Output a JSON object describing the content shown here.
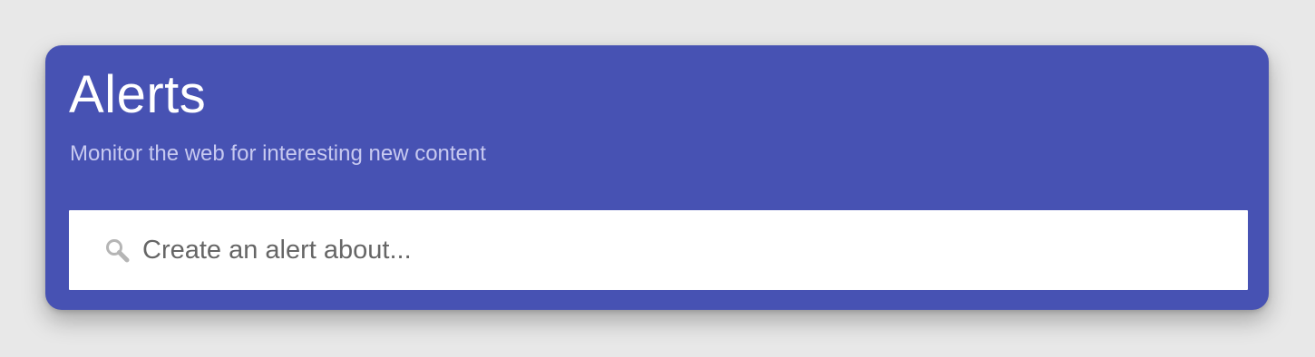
{
  "header": {
    "title": "Alerts",
    "subtitle": "Monitor the web for interesting new content"
  },
  "search": {
    "placeholder": "Create an alert about...",
    "value": "",
    "icon": "search-icon"
  },
  "colors": {
    "page_background": "#e8e8e8",
    "card_background": "#4752b3",
    "title_text": "#ffffff",
    "subtitle_text": "#c7c9f0",
    "input_background": "#ffffff",
    "input_text": "#666666",
    "icon": "#b5b5b5"
  }
}
